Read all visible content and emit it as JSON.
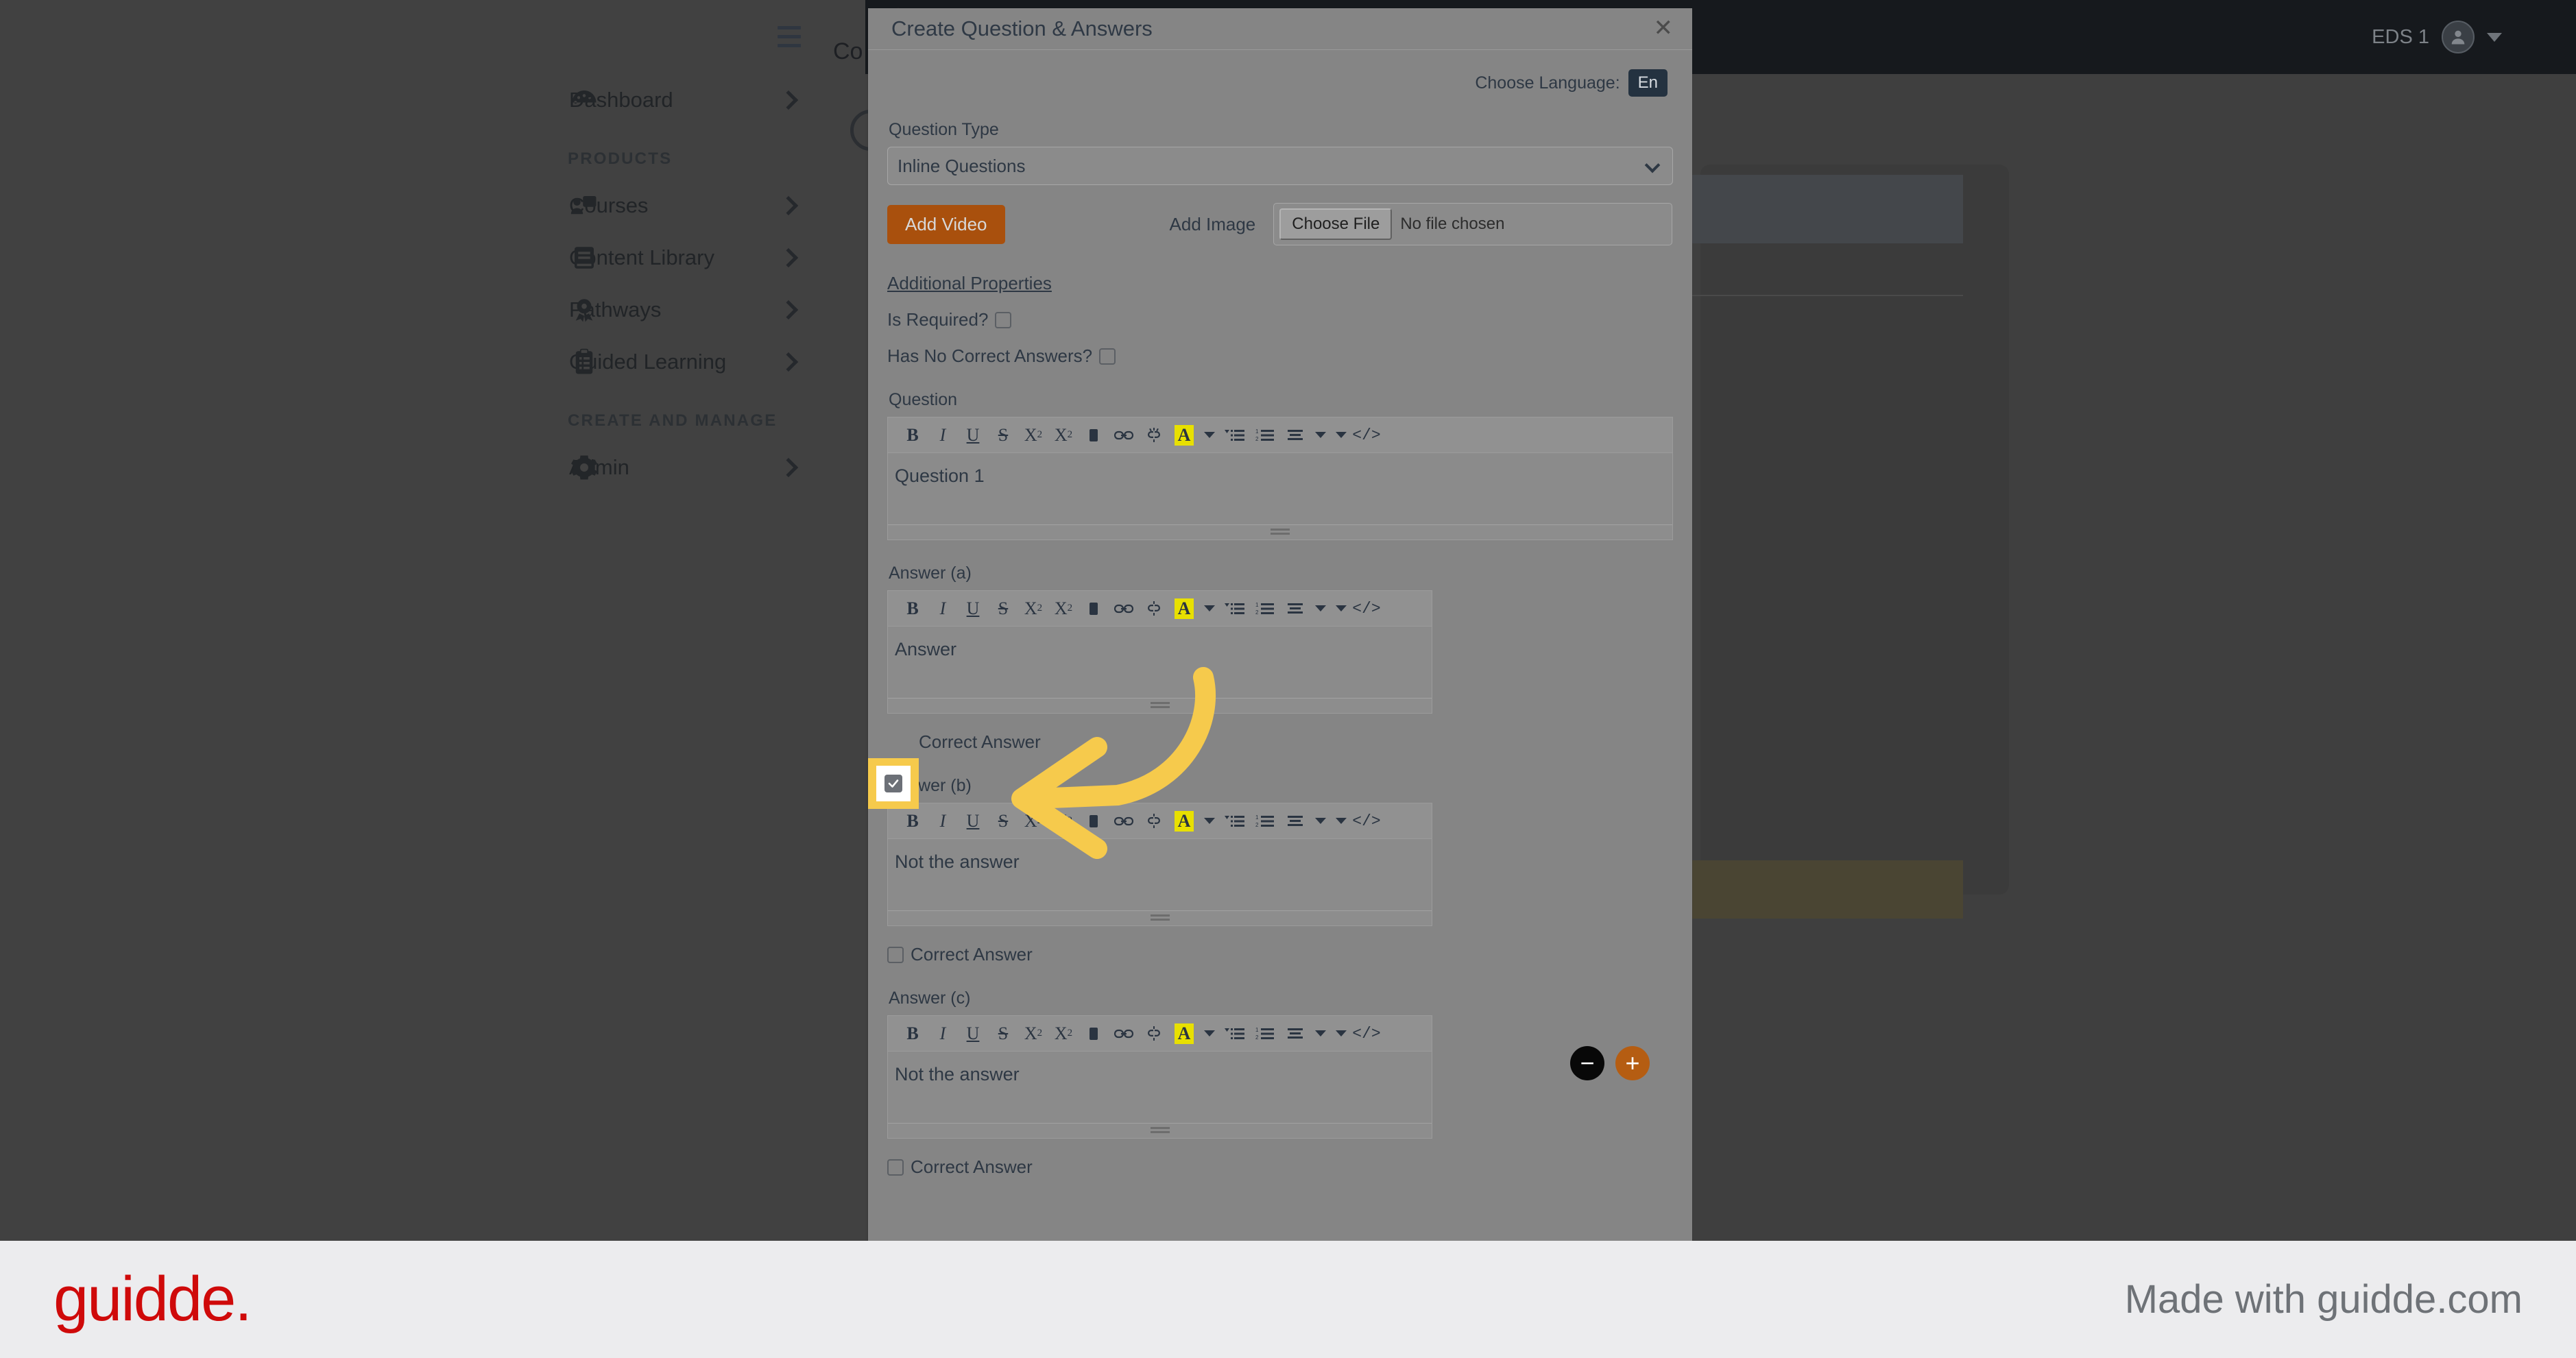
{
  "topbar": {
    "title": "Co",
    "user_name": "EDS 1",
    "hamburger_icon": "hamburger-menu-icon",
    "avatar_icon": "user-avatar-icon",
    "caret_icon": "chevron-down-icon"
  },
  "sidebar": {
    "items": [
      {
        "label": "Dashboard",
        "icon": "speedometer-icon",
        "chevron": "chevron-right-icon"
      }
    ],
    "sections": [
      {
        "title": "PRODUCTS",
        "items": [
          {
            "label": "Courses",
            "icon": "course-presentation-icon",
            "chevron": "chevron-right-icon"
          },
          {
            "label": "Content Library",
            "icon": "book-icon",
            "chevron": "chevron-right-icon"
          },
          {
            "label": "Pathways",
            "icon": "award-ribbon-icon",
            "chevron": "chevron-right-icon"
          },
          {
            "label": "Guided Learning",
            "icon": "clipboard-list-icon",
            "chevron": "chevron-right-icon"
          }
        ]
      },
      {
        "title": "CREATE AND MANAGE",
        "items": [
          {
            "label": "Admin",
            "icon": "gear-icon",
            "chevron": "chevron-right-icon"
          }
        ]
      }
    ]
  },
  "modal": {
    "title": "Create Question & Answers",
    "close_label": "✕",
    "language": {
      "label": "Choose Language:",
      "value": "En"
    },
    "question_type": {
      "label": "Question Type",
      "selected": "Inline Questions",
      "options": [
        "Inline Questions"
      ]
    },
    "media": {
      "add_video_label": "Add Video",
      "add_image_label": "Add Image",
      "choose_file_label": "Choose File",
      "file_status": "No file chosen"
    },
    "additional_properties_label": "Additional Properties",
    "properties": [
      {
        "label": "Is Required?",
        "checked": false
      },
      {
        "label": "Has No Correct Answers?",
        "checked": false
      }
    ],
    "editor_toolbar": {
      "bold": "B",
      "italic": "I",
      "underline": "U",
      "strikethrough": "S",
      "superscript": "X",
      "superscript_sup": "2",
      "subscript": "X",
      "subscript_sub": "2",
      "eraser": "remove-format-icon",
      "link": "link-icon",
      "unlink": "unlink-icon",
      "highlight": "A",
      "bullet_list": "bullet-list-icon",
      "numbered_list": "numbered-list-icon",
      "align": "align-icon",
      "code_view": "</>"
    },
    "question": {
      "label": "Question",
      "text": "Question 1"
    },
    "answers": [
      {
        "label": "Answer (a)",
        "text": "Answer",
        "correct_label": "Correct Answer",
        "checked": true
      },
      {
        "label": "Answer (b)",
        "text": "Not the answer",
        "correct_label": "Correct Answer",
        "checked": false
      },
      {
        "label": "Answer (c)",
        "text": "Not the answer",
        "correct_label": "Correct Answer",
        "checked": false
      }
    ],
    "stepper": {
      "remove_label": "−",
      "add_label": "+"
    }
  },
  "footer": {
    "logo_text": "guidde.",
    "made_with": "Made with guidde.com"
  },
  "colors": {
    "accent_orange": "#a9500d",
    "highlight_yellow": "#f6ca4c",
    "brand_red": "#cf0a0a",
    "modal_bg": "#858585",
    "lang_pill": "#243240"
  }
}
